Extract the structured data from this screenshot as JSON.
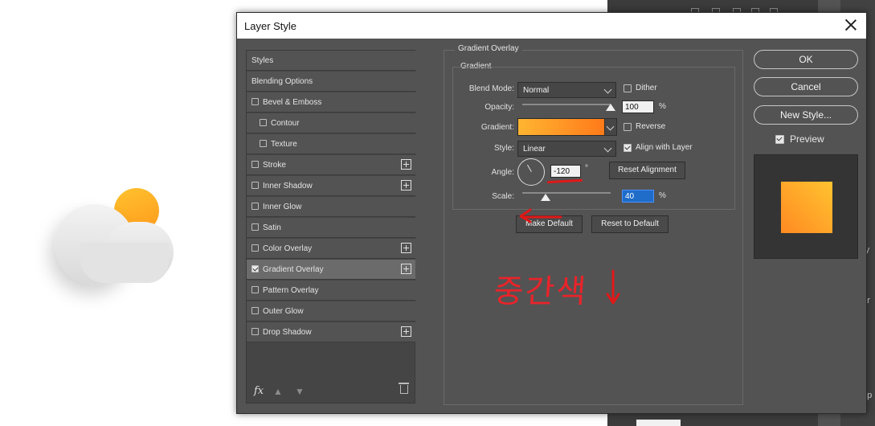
{
  "dialog": {
    "title": "Layer Style"
  },
  "styles_list": {
    "items": [
      {
        "label": "Styles",
        "checkbox": false,
        "checked": false,
        "plus": false,
        "indent": false,
        "selected": false
      },
      {
        "label": "Blending Options",
        "checkbox": false,
        "checked": false,
        "plus": false,
        "indent": false,
        "selected": false
      },
      {
        "label": "Bevel & Emboss",
        "checkbox": true,
        "checked": false,
        "plus": false,
        "indent": false,
        "selected": false
      },
      {
        "label": "Contour",
        "checkbox": true,
        "checked": false,
        "plus": false,
        "indent": true,
        "selected": false
      },
      {
        "label": "Texture",
        "checkbox": true,
        "checked": false,
        "plus": false,
        "indent": true,
        "selected": false
      },
      {
        "label": "Stroke",
        "checkbox": true,
        "checked": false,
        "plus": true,
        "indent": false,
        "selected": false
      },
      {
        "label": "Inner Shadow",
        "checkbox": true,
        "checked": false,
        "plus": true,
        "indent": false,
        "selected": false
      },
      {
        "label": "Inner Glow",
        "checkbox": true,
        "checked": false,
        "plus": false,
        "indent": false,
        "selected": false
      },
      {
        "label": "Satin",
        "checkbox": true,
        "checked": false,
        "plus": false,
        "indent": false,
        "selected": false
      },
      {
        "label": "Color Overlay",
        "checkbox": true,
        "checked": false,
        "plus": true,
        "indent": false,
        "selected": false
      },
      {
        "label": "Gradient Overlay",
        "checkbox": true,
        "checked": true,
        "plus": true,
        "indent": false,
        "selected": true
      },
      {
        "label": "Pattern Overlay",
        "checkbox": true,
        "checked": false,
        "plus": false,
        "indent": false,
        "selected": false
      },
      {
        "label": "Outer Glow",
        "checkbox": true,
        "checked": false,
        "plus": false,
        "indent": false,
        "selected": false
      },
      {
        "label": "Drop Shadow",
        "checkbox": true,
        "checked": false,
        "plus": true,
        "indent": false,
        "selected": false
      }
    ],
    "footer": {
      "fx": "fx"
    }
  },
  "gradient_overlay": {
    "section_title": "Gradient Overlay",
    "group_title": "Gradient",
    "blend_mode_label": "Blend Mode:",
    "blend_mode_value": "Normal",
    "dither_label": "Dither",
    "dither_checked": false,
    "opacity_label": "Opacity:",
    "opacity_value": "100",
    "opacity_unit": "%",
    "opacity_level": 1.0,
    "gradient_label": "Gradient:",
    "gradient_colors": [
      "#ffb531",
      "#ff7a1a"
    ],
    "reverse_label": "Reverse",
    "reverse_checked": false,
    "style_label": "Style:",
    "style_value": "Linear",
    "align_label": "Align with Layer",
    "align_checked": true,
    "angle_label": "Angle:",
    "angle_value": "-120",
    "angle_unit": "°",
    "reset_alignment_label": "Reset Alignment",
    "scale_label": "Scale:",
    "scale_value": "40",
    "scale_unit": "%",
    "make_default_label": "Make Default",
    "reset_default_label": "Reset to Default"
  },
  "actions": {
    "ok_label": "OK",
    "cancel_label": "Cancel",
    "new_style_label": "New Style...",
    "preview_label": "Preview",
    "preview_checked": true
  },
  "annotations": {
    "handwriting": "중간색",
    "color": "#e8242a"
  },
  "background_fragments": {
    "frag1": "ry",
    "frag2": "ar",
    "frag3": "pp"
  }
}
